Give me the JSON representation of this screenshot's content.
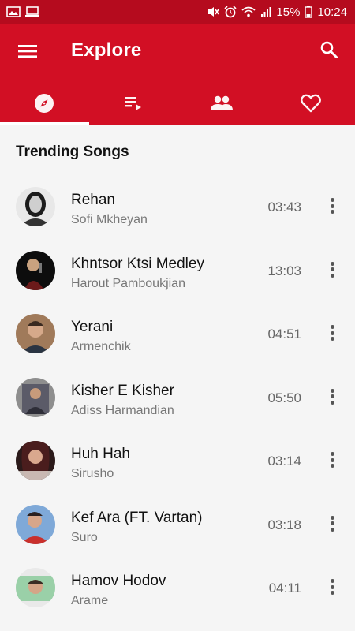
{
  "status_bar": {
    "battery": "15%",
    "time": "10:24"
  },
  "app_bar": {
    "title": "Explore",
    "menu_icon": "hamburger-menu-icon",
    "search_icon": "search-icon",
    "accent_color": "#d20f24",
    "status_color": "#b50b1e"
  },
  "tabs": [
    {
      "icon": "compass-icon",
      "active": true
    },
    {
      "icon": "playlist-icon",
      "active": false
    },
    {
      "icon": "people-icon",
      "active": false
    },
    {
      "icon": "heart-icon",
      "active": false
    }
  ],
  "section": {
    "title": "Trending Songs"
  },
  "songs": [
    {
      "title": "Rehan",
      "artist": "Sofi Mkheyan",
      "duration": "03:43"
    },
    {
      "title": "Khntsor Ktsi Medley",
      "artist": "Harout Pamboukjian",
      "duration": "13:03"
    },
    {
      "title": "Yerani",
      "artist": "Armenchik",
      "duration": "04:51"
    },
    {
      "title": "Kisher E Kisher",
      "artist": "Adiss Harmandian",
      "duration": "05:50"
    },
    {
      "title": "Huh Hah",
      "artist": "Sirusho",
      "duration": "03:14"
    },
    {
      "title": "Kef Ara (FT. Vartan)",
      "artist": "Suro",
      "duration": "03:18"
    },
    {
      "title": "Hamov Hodov",
      "artist": "Arame",
      "duration": "04:11"
    }
  ]
}
